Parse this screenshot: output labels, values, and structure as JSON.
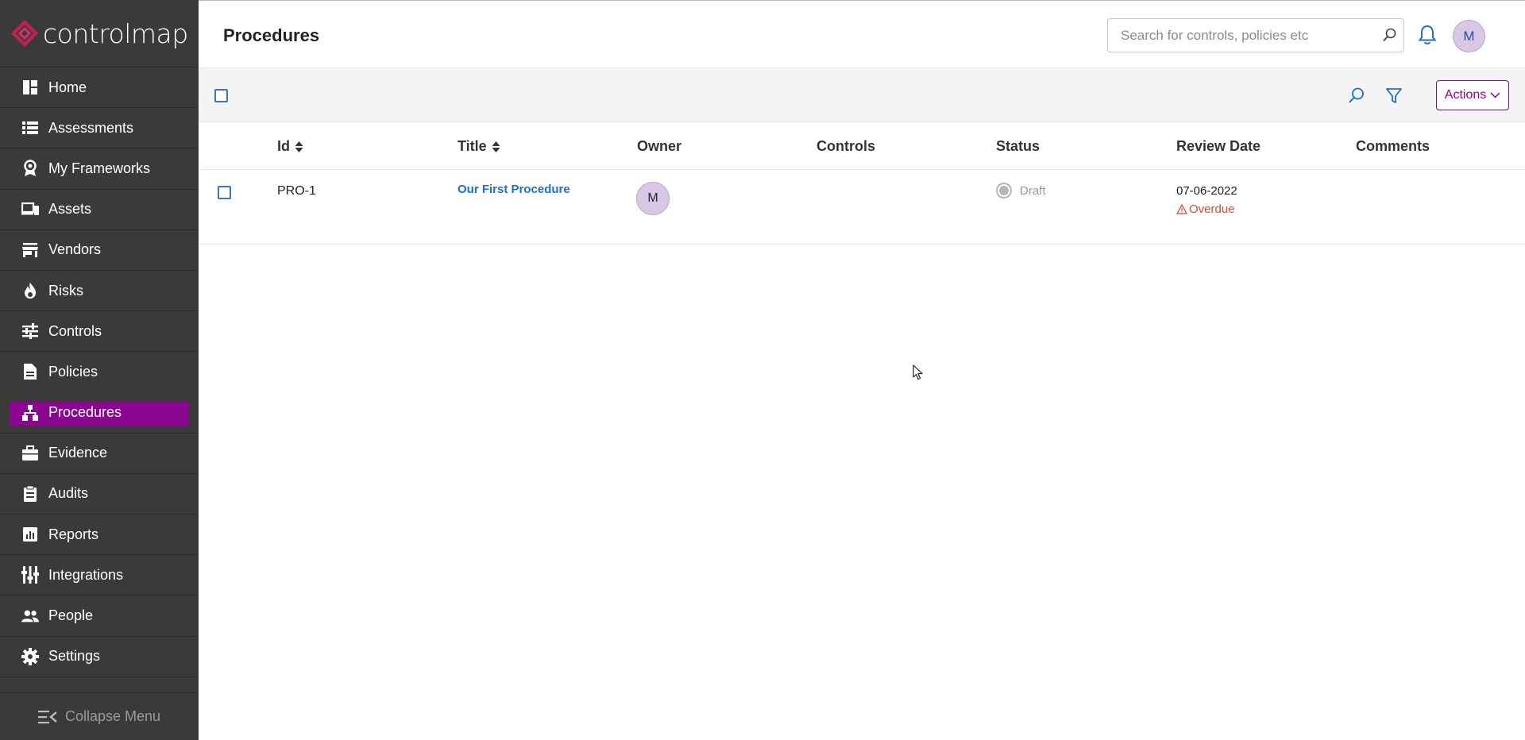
{
  "app": {
    "logo_text": "controlmap"
  },
  "sidebar": {
    "items": [
      {
        "label": "Home",
        "icon": "dashboard-icon"
      },
      {
        "label": "Assessments",
        "icon": "list-icon"
      },
      {
        "label": "My Frameworks",
        "icon": "badge-icon"
      },
      {
        "label": "Assets",
        "icon": "devices-icon"
      },
      {
        "label": "Vendors",
        "icon": "store-icon"
      },
      {
        "label": "Risks",
        "icon": "flame-icon"
      },
      {
        "label": "Controls",
        "icon": "sliders-icon"
      },
      {
        "label": "Policies",
        "icon": "document-icon"
      },
      {
        "label": "Procedures",
        "icon": "hierarchy-icon",
        "active": true
      },
      {
        "label": "Evidence",
        "icon": "briefcase-icon"
      },
      {
        "label": "Audits",
        "icon": "clipboard-icon"
      },
      {
        "label": "Reports",
        "icon": "report-icon"
      },
      {
        "label": "Integrations",
        "icon": "integrations-icon"
      },
      {
        "label": "People",
        "icon": "people-icon"
      },
      {
        "label": "Settings",
        "icon": "gear-icon"
      }
    ],
    "collapse_label": "Collapse Menu"
  },
  "header": {
    "title": "Procedures",
    "search_placeholder": "Search for controls, policies etc",
    "user_initial": "M"
  },
  "toolbar": {
    "actions_label": "Actions"
  },
  "table": {
    "columns": [
      "Id",
      "Title",
      "Owner",
      "Controls",
      "Status",
      "Review Date",
      "Comments"
    ],
    "rows": [
      {
        "id": "PRO-1",
        "title": "Our First Procedure",
        "owner_initial": "M",
        "controls": "",
        "status": "Draft",
        "review_date": "07-06-2022",
        "review_flag": "Overdue",
        "comments": ""
      }
    ]
  },
  "colors": {
    "accent": "#8a068f",
    "sidebar_bg": "#3a3a3a",
    "link": "#1f6fc4",
    "danger": "#e0453e"
  }
}
